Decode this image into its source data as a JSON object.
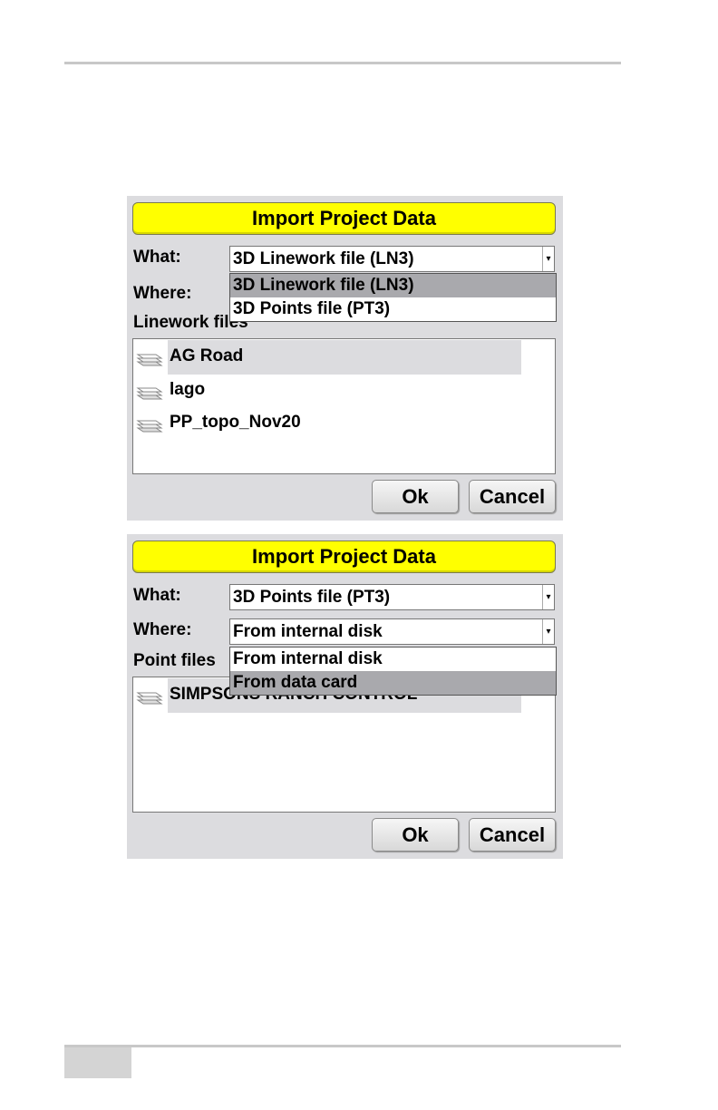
{
  "dialog1": {
    "title": "Import Project Data",
    "what_label": "What:",
    "what_value": "3D Linework file (LN3)",
    "where_label": "Where:",
    "list_label": "Linework files",
    "what_options": [
      "3D Linework file (LN3)",
      "3D Points file (PT3)"
    ],
    "files": [
      "AG Road",
      "lago",
      "PP_topo_Nov20"
    ],
    "ok": "Ok",
    "cancel": "Cancel"
  },
  "dialog2": {
    "title": "Import Project Data",
    "what_label": "What:",
    "what_value": "3D Points file (PT3)",
    "where_label": "Where:",
    "where_value": "From internal disk",
    "list_label": "Point files",
    "where_options": [
      "From internal disk",
      "From data card"
    ],
    "files": [
      "SIMPSONS RANCH CONTROL"
    ],
    "ok": "Ok",
    "cancel": "Cancel"
  },
  "colors": {
    "title_bar": "#ffff00",
    "dialog_bg": "#dcdcdf",
    "selection": "#a9a9ad"
  }
}
